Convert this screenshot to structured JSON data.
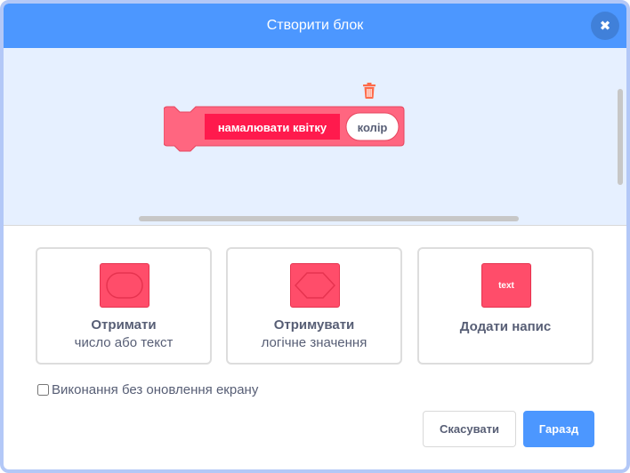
{
  "dialog": {
    "title": "Створити блок",
    "close_icon": "close-icon"
  },
  "workspace": {
    "block": {
      "label": "намалювати квітку",
      "argument": "колір",
      "color": "#ff6680",
      "label_highlight": "#ff1a4d"
    },
    "trash_icon": "trash-icon"
  },
  "options": [
    {
      "icon": "number-text-input-icon",
      "title": "Отримати",
      "subtitle": "число або текст"
    },
    {
      "icon": "boolean-input-icon",
      "title": "Отримувати",
      "subtitle": "логічне значення"
    },
    {
      "icon": "label-text-icon",
      "icon_text": "text",
      "title": "Додати напис"
    }
  ],
  "run_without_refresh": {
    "label": "Виконання без оновлення екрану",
    "checked": false
  },
  "buttons": {
    "cancel": "Скасувати",
    "ok": "Гаразд"
  },
  "colors": {
    "header": "#4c97ff",
    "workspace_bg": "#e6f0ff",
    "accent": "#ff4d6a",
    "text": "#575e75"
  }
}
